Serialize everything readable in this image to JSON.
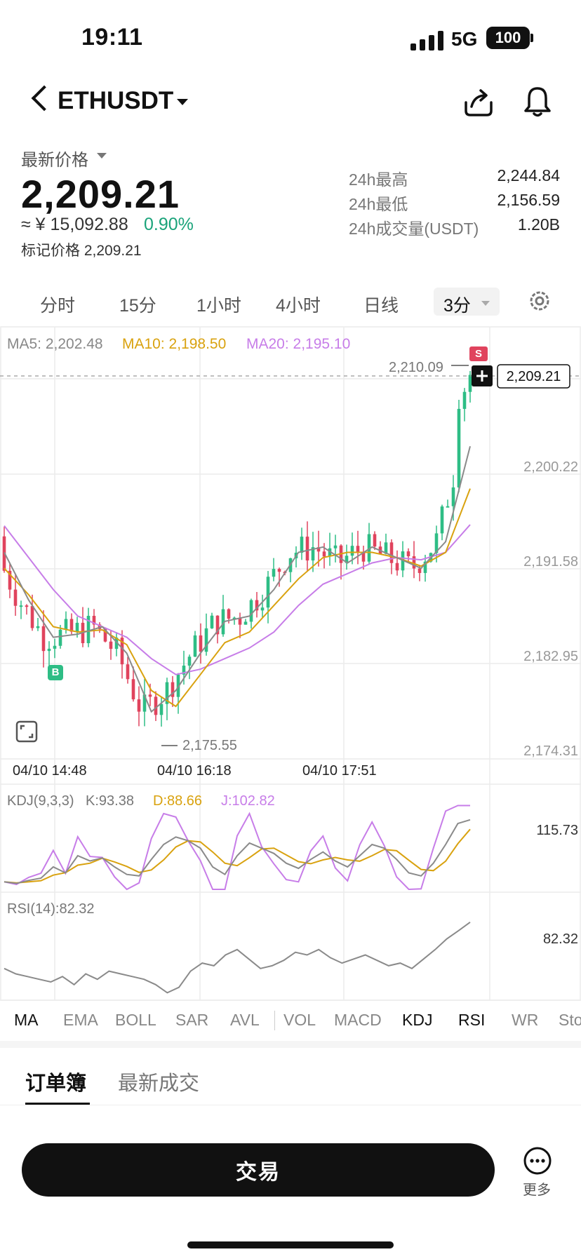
{
  "status_bar": {
    "time": "19:11",
    "network": "5G",
    "battery": "100"
  },
  "header": {
    "symbol": "ETHUSDT"
  },
  "price": {
    "latest_label": "最新价格",
    "last": "2,209.21",
    "cny": "≈ ¥ 15,092.88",
    "change_pct": "0.90%",
    "mark_price": "标记价格 2,209.21"
  },
  "stats": [
    {
      "label": "24h最高",
      "value": "2,244.84"
    },
    {
      "label": "24h最低",
      "value": "2,156.59"
    },
    {
      "label": "24h成交量(USDT)",
      "value": "1.20B"
    }
  ],
  "intervals": [
    "分时",
    "15分",
    "1小时",
    "4小时",
    "日线"
  ],
  "interval_active": "3分",
  "chart": {
    "ma5": "MA5: 2,202.48",
    "ma10": "MA10: 2,198.50",
    "ma20": "MA20: 2,195.10",
    "high_marker": "2,210.09",
    "low_marker": "2,175.55",
    "current_price_tag": "2,209.21",
    "sell_badge": "S",
    "buy_badge": "B",
    "y_ticks": [
      "2,200.22",
      "2,191.58",
      "2,182.95",
      "2,174.31"
    ],
    "x_ticks": [
      "04/10 14:48",
      "04/10 16:18",
      "04/10 17:51"
    ],
    "kdj_name": "KDJ(9,3,3)",
    "kdj_k": "K:93.38",
    "kdj_d": "D:88.66",
    "kdj_j": "J:102.82",
    "kdj_axis": "115.73",
    "rsi_name": "RSI(14):82.32",
    "rsi_axis": "82.32",
    "colors": {
      "up": "#2ebd85",
      "down": "#e0435d",
      "ma5": "#8a8a8a",
      "ma10": "#d9a20f",
      "ma20": "#c77de8"
    }
  },
  "chart_data": {
    "type": "line",
    "title": "ETHUSDT 3分",
    "x_ticks": [
      "04/10 14:48",
      "04/10 16:18",
      "04/10 17:51"
    ],
    "ylim": [
      2174.31,
      2210.09
    ],
    "series": [
      {
        "name": "MA5",
        "values": [
          2192.5,
          2188.0,
          2184.5,
          2184.8,
          2185.5,
          2183.0,
          2177.5,
          2179.5,
          2183.0,
          2186.0,
          2186.5,
          2189.0,
          2192.5,
          2193.0,
          2191.5,
          2193.0,
          2192.0,
          2191.0,
          2193.5,
          2202.48
        ]
      },
      {
        "name": "MA10",
        "values": [
          2191.0,
          2188.5,
          2185.5,
          2185.0,
          2185.2,
          2183.8,
          2179.5,
          2178.0,
          2181.0,
          2184.0,
          2185.0,
          2187.5,
          2190.0,
          2192.0,
          2192.5,
          2192.5,
          2192.0,
          2191.2,
          2192.5,
          2198.5
        ]
      },
      {
        "name": "MA20",
        "values": [
          2195.0,
          2192.0,
          2189.0,
          2186.5,
          2185.5,
          2184.5,
          2182.5,
          2181.0,
          2181.5,
          2182.5,
          2183.5,
          2185.0,
          2187.5,
          2189.5,
          2190.5,
          2191.5,
          2192.0,
          2191.8,
          2192.5,
          2195.1
        ]
      }
    ],
    "grid": true
  }
}
